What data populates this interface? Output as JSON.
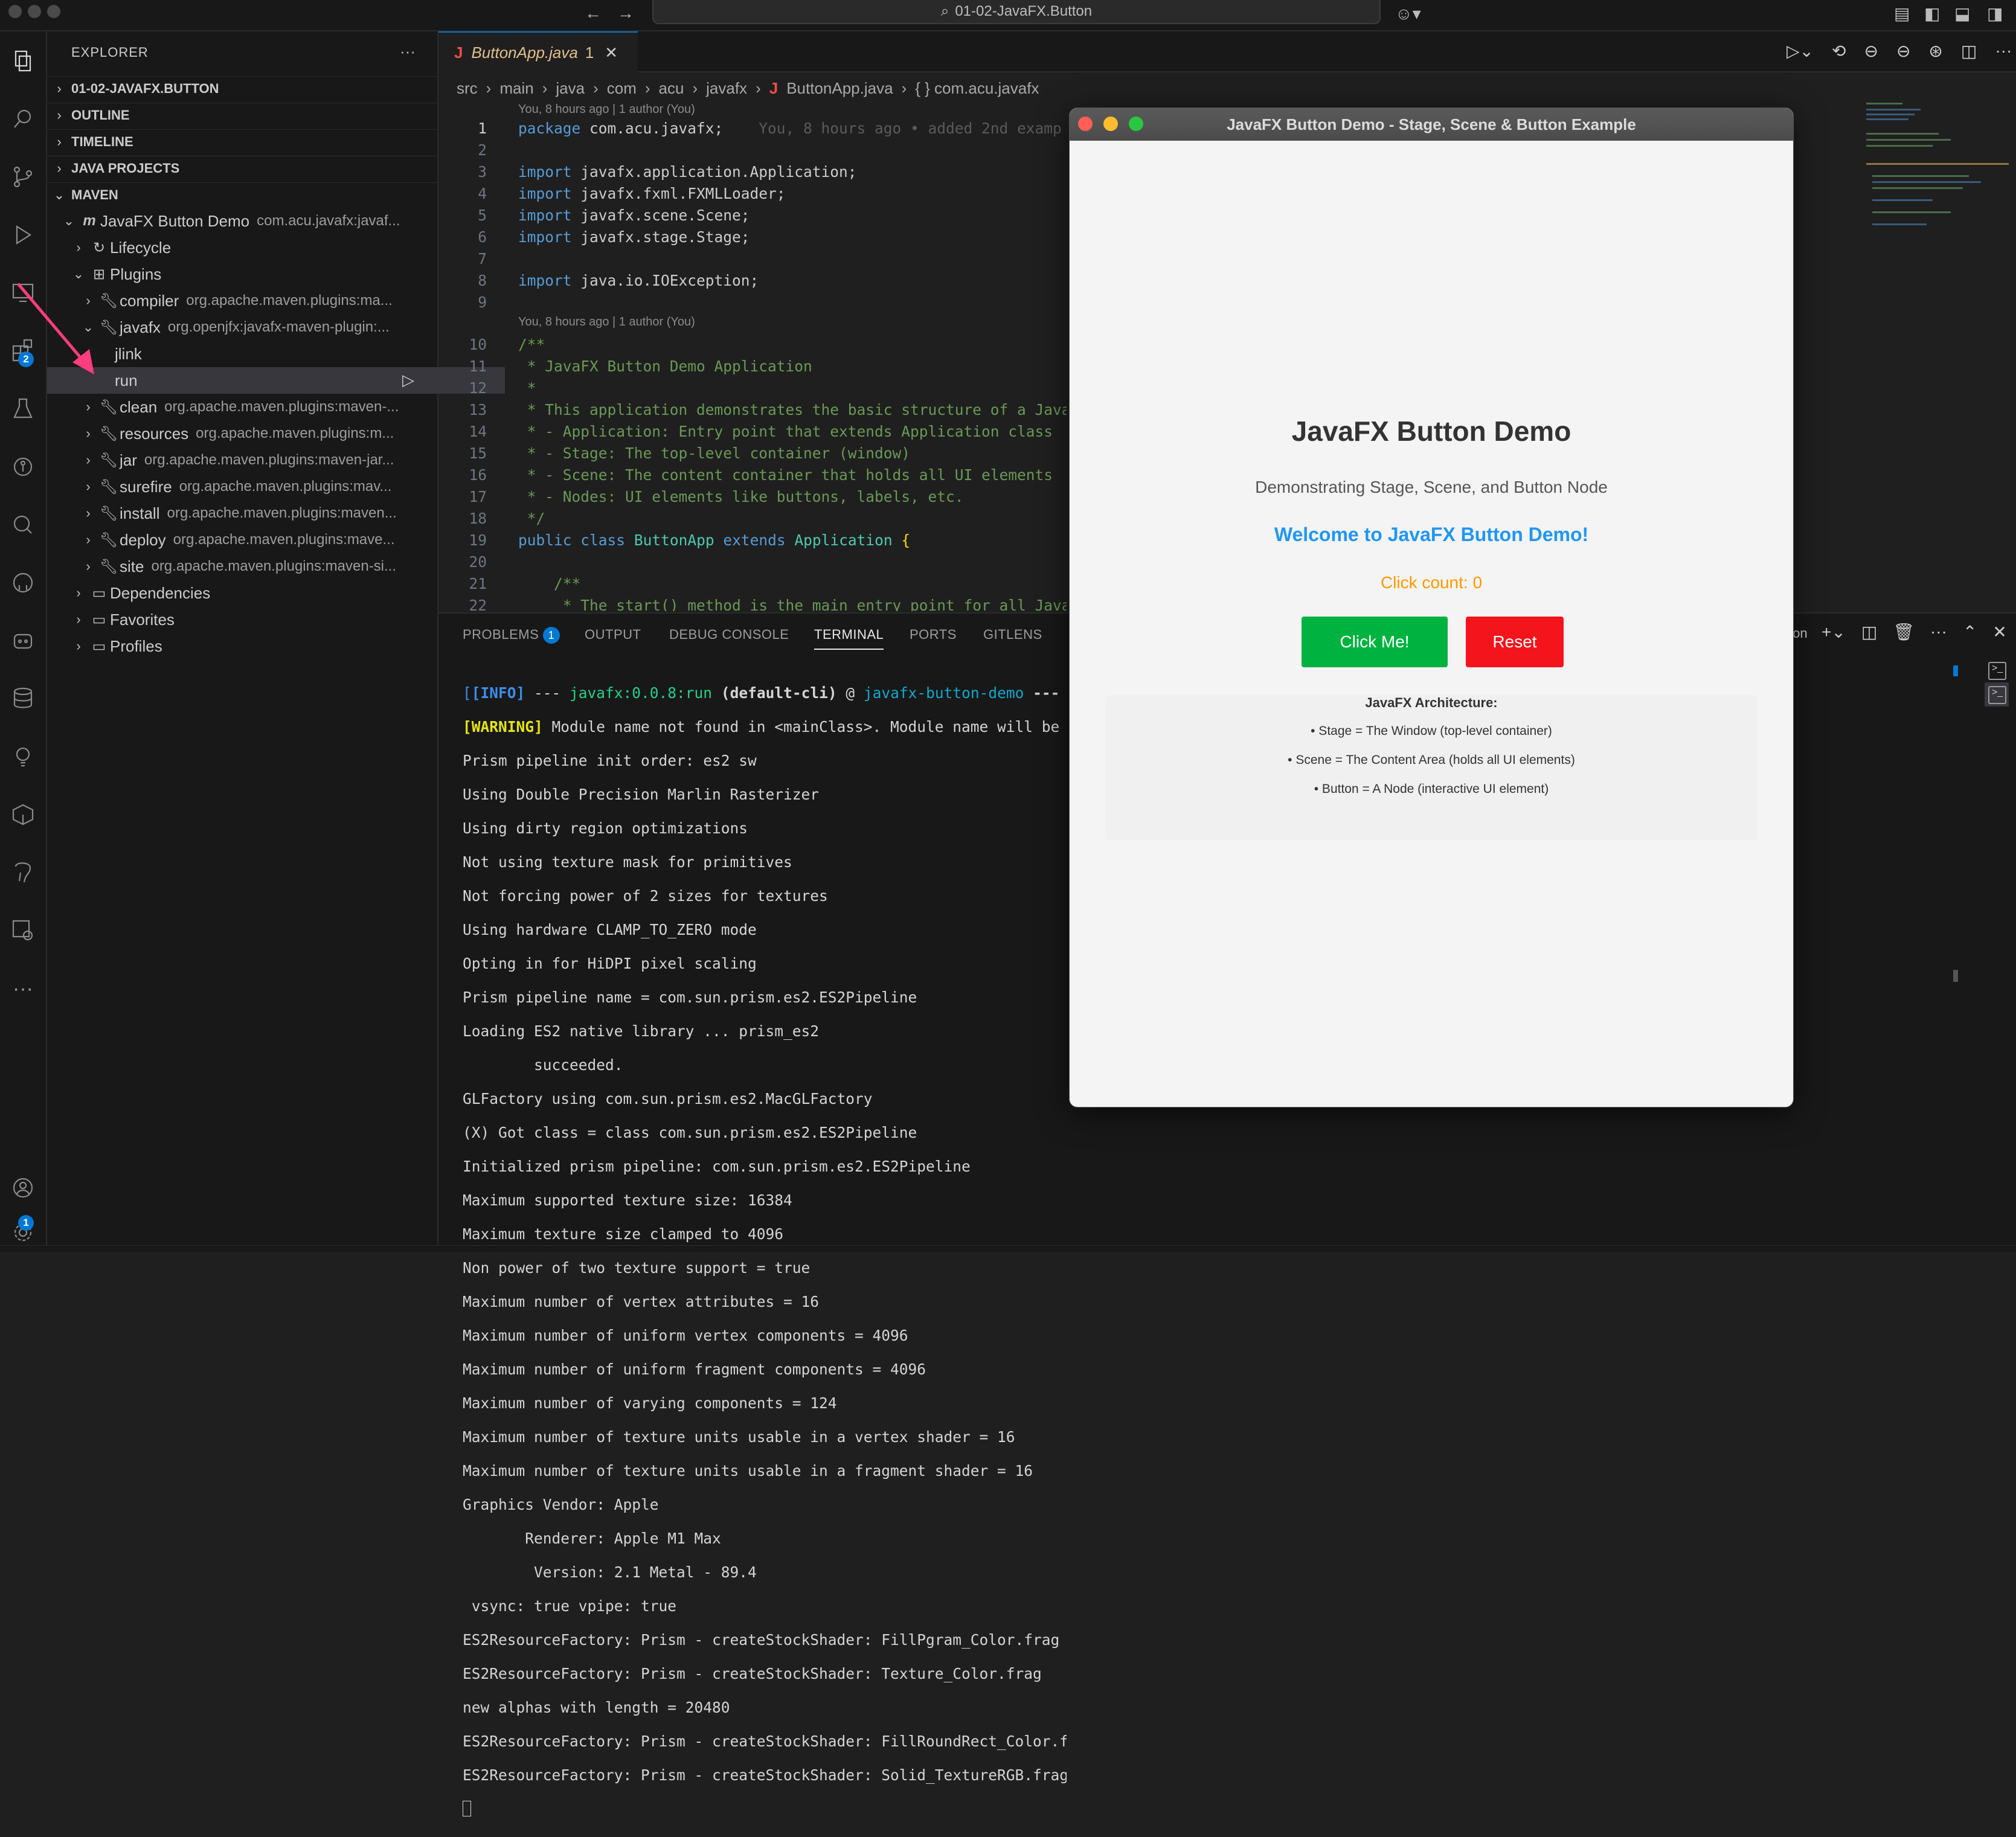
{
  "titlebar": {
    "command_center": "01-02-JavaFX.Button"
  },
  "activity": {
    "extensions_badge": "2",
    "settings_badge": "1"
  },
  "explorer": {
    "title": "EXPLORER",
    "sections": {
      "folder": "01-02-JAVAFX.BUTTON",
      "outline": "OUTLINE",
      "timeline": "TIMELINE",
      "java_projects": "JAVA PROJECTS",
      "maven": "MAVEN"
    },
    "maven": {
      "project": {
        "label": "JavaFX Button Demo",
        "desc": "com.acu.javafx:javaf..."
      },
      "lifecycle": "Lifecycle",
      "plugins": "Plugins",
      "plugin_items": [
        {
          "label": "compiler",
          "desc": "org.apache.maven.plugins:ma..."
        },
        {
          "label": "javafx",
          "desc": "org.openjfx:javafx-maven-plugin:..."
        },
        {
          "label": "jlink"
        },
        {
          "label": "run"
        },
        {
          "label": "clean",
          "desc": "org.apache.maven.plugins:maven-..."
        },
        {
          "label": "resources",
          "desc": "org.apache.maven.plugins:m..."
        },
        {
          "label": "jar",
          "desc": "org.apache.maven.plugins:maven-jar..."
        },
        {
          "label": "surefire",
          "desc": "org.apache.maven.plugins:mav..."
        },
        {
          "label": "install",
          "desc": "org.apache.maven.plugins:maven..."
        },
        {
          "label": "deploy",
          "desc": "org.apache.maven.plugins:mave..."
        },
        {
          "label": "site",
          "desc": "org.apache.maven.plugins:maven-si..."
        }
      ],
      "dependencies": "Dependencies",
      "favorites": "Favorites",
      "profiles": "Profiles"
    }
  },
  "editor": {
    "tab": {
      "name": "ButtonApp.java",
      "problems": "1"
    },
    "breadcrumb": [
      "src",
      "main",
      "java",
      "com",
      "acu",
      "javafx",
      "ButtonApp.java",
      "{ } com.acu.javafx"
    ],
    "codelens1": "You, 8 hours ago | 1 author (You)",
    "codelens2": "You, 8 hours ago | 1 author (You)",
    "blame": "You, 8 hours ago • added 2nd examp",
    "lines": [
      {
        "n": "1",
        "kw": "package",
        "rest": " com.acu.javafx;"
      },
      {
        "n": "2"
      },
      {
        "n": "3",
        "kw": "import",
        "rest": " javafx.application.Application;"
      },
      {
        "n": "4",
        "kw": "import",
        "rest": " javafx.fxml.FXMLLoader;"
      },
      {
        "n": "5",
        "kw": "import",
        "rest": " javafx.scene.Scene;"
      },
      {
        "n": "6",
        "kw": "import",
        "rest": " javafx.stage.Stage;"
      },
      {
        "n": "7"
      },
      {
        "n": "8",
        "kw": "import",
        "rest": " java.io.IOException;"
      },
      {
        "n": "9"
      },
      {
        "n": "10",
        "comment": "/**"
      },
      {
        "n": "11",
        "comment": " * JavaFX Button Demo Application"
      },
      {
        "n": "12",
        "comment": " *"
      },
      {
        "n": "13",
        "comment": " * This application demonstrates the basic structure of a JavaF"
      },
      {
        "n": "14",
        "comment": " * - Application: Entry point that extends Application class"
      },
      {
        "n": "15",
        "comment": " * - Stage: The top-level container (window)"
      },
      {
        "n": "16",
        "comment": " * - Scene: The content container that holds all UI elements"
      },
      {
        "n": "17",
        "comment": " * - Nodes: UI elements like buttons, labels, etc."
      },
      {
        "n": "18",
        "comment": " */"
      },
      {
        "n": "19"
      },
      {
        "n": "20"
      },
      {
        "n": "21",
        "comment": "    /**"
      },
      {
        "n": "22",
        "comment": "     * The start() method is the main entry point for all JavaF"
      }
    ],
    "line19": {
      "public": "public",
      "class": "class",
      "name": "ButtonApp",
      "extends": "extends",
      "parent": "Application",
      "brace": "{"
    }
  },
  "panel": {
    "tabs": [
      "PROBLEMS",
      "OUTPUT",
      "DEBUG CONSOLE",
      "TERMINAL",
      "PORTS",
      "GITLENS"
    ],
    "problems_badge": "1",
    "active_tab": "TERMINAL",
    "terminal_label_clipped": "ton",
    "terminal": {
      "line1": {
        "info": "[INFO]",
        "sep": " --- ",
        "goal": "javafx:0.0.8:run",
        "exec": " (default-cli)",
        "at": " @ ",
        "project": "javafx-button-demo",
        "end": " ---"
      },
      "line2": {
        "warn": "[WARNING]",
        "text": " Module name not found in <mainClass>. Module name will be assu"
      },
      "lines": [
        "Prism pipeline init order: es2 sw",
        "Using Double Precision Marlin Rasterizer",
        "Using dirty region optimizations",
        "Not using texture mask for primitives",
        "Not forcing power of 2 sizes for textures",
        "Using hardware CLAMP_TO_ZERO mode",
        "Opting in for HiDPI pixel scaling",
        "Prism pipeline name = com.sun.prism.es2.ES2Pipeline",
        "Loading ES2 native library ... prism_es2",
        "        succeeded.",
        "GLFactory using com.sun.prism.es2.MacGLFactory",
        "(X) Got class = class com.sun.prism.es2.ES2Pipeline",
        "Initialized prism pipeline: com.sun.prism.es2.ES2Pipeline",
        "Maximum supported texture size: 16384",
        "Maximum texture size clamped to 4096",
        "Non power of two texture support = true",
        "Maximum number of vertex attributes = 16",
        "Maximum number of uniform vertex components = 4096",
        "Maximum number of uniform fragment components = 4096",
        "Maximum number of varying components = 124",
        "Maximum number of texture units usable in a vertex shader = 16",
        "Maximum number of texture units usable in a fragment shader = 16",
        "Graphics Vendor: Apple",
        "       Renderer: Apple M1 Max",
        "        Version: 2.1 Metal - 89.4",
        " vsync: true vpipe: true",
        "ES2ResourceFactory: Prism - createStockShader: FillPgram_Color.frag",
        "ES2ResourceFactory: Prism - createStockShader: Texture_Color.frag",
        "new alphas with length = 20480",
        "ES2ResourceFactory: Prism - createStockShader: FillRoundRect_Color.frag",
        "ES2ResourceFactory: Prism - createStockShader: Solid_TextureRGB.frag"
      ]
    }
  },
  "fxwindow": {
    "title": "JavaFX Button Demo - Stage, Scene & Button Example",
    "heading": "JavaFX Button Demo",
    "subtitle": "Demonstrating Stage, Scene, and Button Node",
    "welcome": "Welcome to JavaFX Button Demo!",
    "click_count": "Click count: 0",
    "click_button": "Click Me!",
    "reset_button": "Reset",
    "arch_title": "JavaFX Architecture:",
    "arch_lines": [
      "• Stage = The Window (top-level container)",
      "• Scene = The Content Area (holds all UI elements)",
      "• Button = A Node (interactive UI element)"
    ],
    "colors": {
      "welcome": "#2196f3",
      "count": "#ff9800",
      "click": "#00b340",
      "reset": "#f4141c"
    }
  }
}
